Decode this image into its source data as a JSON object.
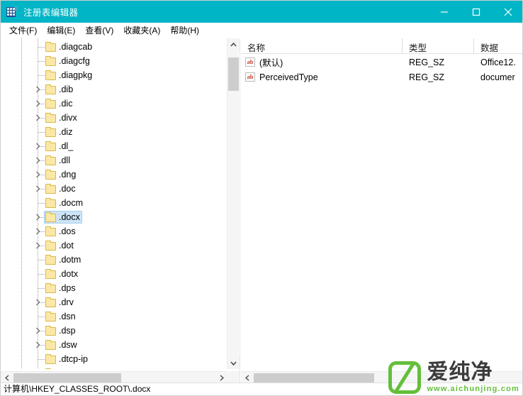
{
  "window": {
    "title": "注册表编辑器",
    "icon": "registry-grid-icon",
    "titlebar_color": "#00b5c6",
    "controls": {
      "minimize": "—",
      "maximize": "▢",
      "close": "✕"
    }
  },
  "menubar": {
    "items": [
      {
        "label": "文件(F)"
      },
      {
        "label": "编辑(E)"
      },
      {
        "label": "查看(V)"
      },
      {
        "label": "收藏夹(A)"
      },
      {
        "label": "帮助(H)"
      }
    ]
  },
  "tree": {
    "selected_key": ".docx",
    "items": [
      {
        "label": ".diagcab",
        "expandable": false,
        "selected": false
      },
      {
        "label": ".diagcfg",
        "expandable": false,
        "selected": false
      },
      {
        "label": ".diagpkg",
        "expandable": false,
        "selected": false
      },
      {
        "label": ".dib",
        "expandable": true,
        "selected": false
      },
      {
        "label": ".dic",
        "expandable": true,
        "selected": false
      },
      {
        "label": ".divx",
        "expandable": true,
        "selected": false
      },
      {
        "label": ".diz",
        "expandable": false,
        "selected": false
      },
      {
        "label": ".dl_",
        "expandable": true,
        "selected": false
      },
      {
        "label": ".dll",
        "expandable": true,
        "selected": false
      },
      {
        "label": ".dng",
        "expandable": true,
        "selected": false
      },
      {
        "label": ".doc",
        "expandable": true,
        "selected": false
      },
      {
        "label": ".docm",
        "expandable": false,
        "selected": false
      },
      {
        "label": ".docx",
        "expandable": true,
        "selected": true
      },
      {
        "label": ".dos",
        "expandable": true,
        "selected": false
      },
      {
        "label": ".dot",
        "expandable": true,
        "selected": false
      },
      {
        "label": ".dotm",
        "expandable": false,
        "selected": false
      },
      {
        "label": ".dotx",
        "expandable": false,
        "selected": false
      },
      {
        "label": ".dps",
        "expandable": false,
        "selected": false
      },
      {
        "label": ".drv",
        "expandable": true,
        "selected": false
      },
      {
        "label": ".dsn",
        "expandable": false,
        "selected": false
      },
      {
        "label": ".dsp",
        "expandable": true,
        "selected": false
      },
      {
        "label": ".dsw",
        "expandable": true,
        "selected": false
      },
      {
        "label": ".dtcp-ip",
        "expandable": false,
        "selected": false
      },
      {
        "label": ".dvr-ms",
        "expandable": false,
        "selected": false
      }
    ]
  },
  "values": {
    "columns": [
      {
        "label": "名称"
      },
      {
        "label": "类型"
      },
      {
        "label": "数据"
      }
    ],
    "rows": [
      {
        "icon": "string-value-icon",
        "name": "(默认)",
        "type": "REG_SZ",
        "data": "Office12."
      },
      {
        "icon": "string-value-icon",
        "name": "PerceivedType",
        "type": "REG_SZ",
        "data": "documer"
      }
    ]
  },
  "statusbar": {
    "path": "计算机\\HKEY_CLASSES_ROOT\\.docx"
  },
  "watermark": {
    "brand": "爱纯净",
    "url": "www.aichunjing.com",
    "accent_color": "#63bf3a"
  }
}
